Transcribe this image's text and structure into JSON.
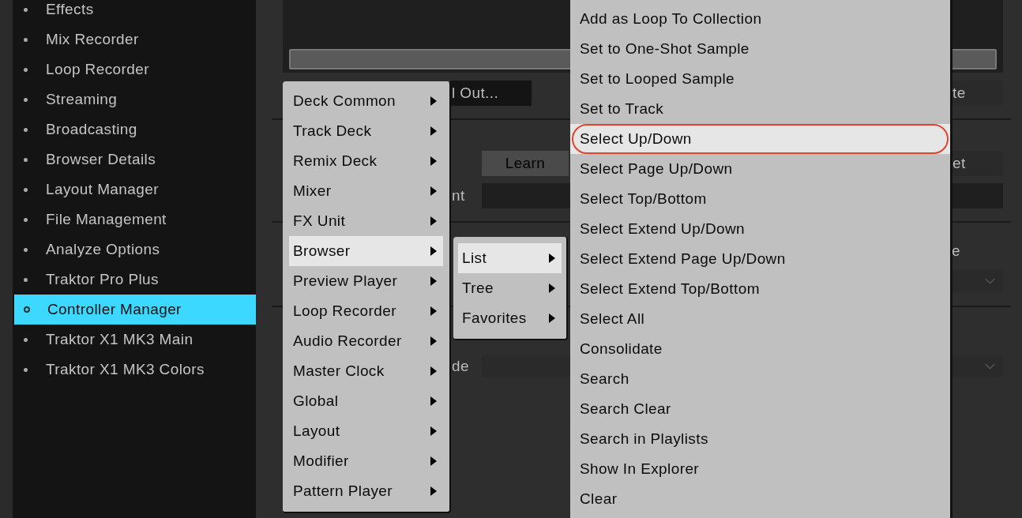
{
  "sidebar": {
    "items": [
      {
        "label": "Effects",
        "selected": false
      },
      {
        "label": "Mix Recorder",
        "selected": false
      },
      {
        "label": "Loop Recorder",
        "selected": false
      },
      {
        "label": "Streaming",
        "selected": false
      },
      {
        "label": "Broadcasting",
        "selected": false
      },
      {
        "label": "Browser Details",
        "selected": false
      },
      {
        "label": "Layout Manager",
        "selected": false
      },
      {
        "label": "File Management",
        "selected": false
      },
      {
        "label": "Analyze Options",
        "selected": false
      },
      {
        "label": "Traktor Pro Plus",
        "selected": false
      },
      {
        "label": "Controller Manager",
        "selected": true
      },
      {
        "label": "Traktor X1 MK3 Main",
        "selected": false
      },
      {
        "label": "Traktor X1 MK3 Colors",
        "selected": false
      }
    ]
  },
  "settings_panel": {
    "button_1": "l Out...",
    "button_2": "te",
    "learn_button": "Learn",
    "button_3": "et",
    "label_1": "nt",
    "label_2": "e",
    "label_3": "de"
  },
  "context_menu": {
    "items": [
      {
        "label": "Deck Common",
        "has_submenu": true,
        "selected": false
      },
      {
        "label": "Track Deck",
        "has_submenu": true,
        "selected": false
      },
      {
        "label": "Remix Deck",
        "has_submenu": true,
        "selected": false
      },
      {
        "label": "Mixer",
        "has_submenu": true,
        "selected": false
      },
      {
        "label": "FX Unit",
        "has_submenu": true,
        "selected": false
      },
      {
        "label": "Browser",
        "has_submenu": true,
        "selected": true
      },
      {
        "label": "Preview Player",
        "has_submenu": true,
        "selected": false
      },
      {
        "label": "Loop Recorder",
        "has_submenu": true,
        "selected": false
      },
      {
        "label": "Audio Recorder",
        "has_submenu": true,
        "selected": false
      },
      {
        "label": "Master Clock",
        "has_submenu": true,
        "selected": false
      },
      {
        "label": "Global",
        "has_submenu": true,
        "selected": false
      },
      {
        "label": "Layout",
        "has_submenu": true,
        "selected": false
      },
      {
        "label": "Modifier",
        "has_submenu": true,
        "selected": false
      },
      {
        "label": "Pattern Player",
        "has_submenu": true,
        "selected": false
      }
    ]
  },
  "submenu": {
    "items": [
      {
        "label": "List",
        "has_submenu": true,
        "selected": true
      },
      {
        "label": "Tree",
        "has_submenu": true,
        "selected": false
      },
      {
        "label": "Favorites",
        "has_submenu": true,
        "selected": false
      }
    ]
  },
  "submenu_2": {
    "items": [
      {
        "label": "Add as Loop To Collection",
        "selected": false,
        "circled": false
      },
      {
        "label": "Set to One-Shot Sample",
        "selected": false,
        "circled": false
      },
      {
        "label": "Set to Looped Sample",
        "selected": false,
        "circled": false
      },
      {
        "label": "Set to Track",
        "selected": false,
        "circled": false
      },
      {
        "label": "Select Up/Down",
        "selected": true,
        "circled": true
      },
      {
        "label": "Select Page Up/Down",
        "selected": false,
        "circled": false
      },
      {
        "label": "Select Top/Bottom",
        "selected": false,
        "circled": false
      },
      {
        "label": "Select Extend Up/Down",
        "selected": false,
        "circled": false
      },
      {
        "label": "Select Extend Page Up/Down",
        "selected": false,
        "circled": false
      },
      {
        "label": "Select Extend Top/Bottom",
        "selected": false,
        "circled": false
      },
      {
        "label": "Select All",
        "selected": false,
        "circled": false
      },
      {
        "label": "Consolidate",
        "selected": false,
        "circled": false
      },
      {
        "label": "Search",
        "selected": false,
        "circled": false
      },
      {
        "label": "Search Clear",
        "selected": false,
        "circled": false
      },
      {
        "label": "Search in Playlists",
        "selected": false,
        "circled": false
      },
      {
        "label": "Show In Explorer",
        "selected": false,
        "circled": false
      },
      {
        "label": "Clear",
        "selected": false,
        "circled": false
      }
    ]
  }
}
